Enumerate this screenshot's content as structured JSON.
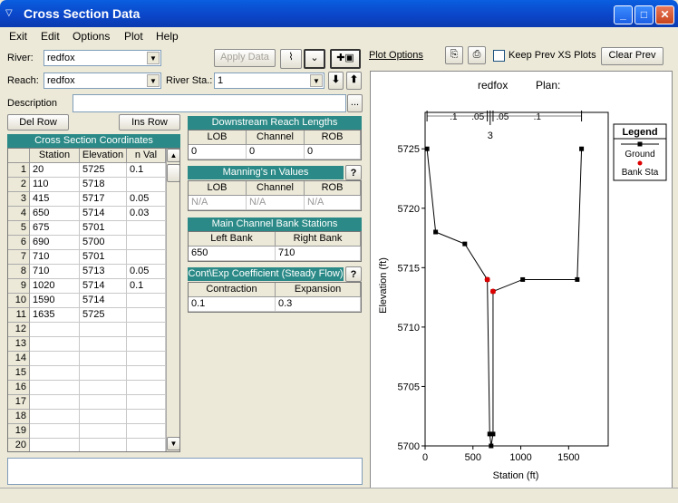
{
  "window": {
    "title": "Cross Section Data"
  },
  "menu": [
    "Exit",
    "Edit",
    "Options",
    "Plot",
    "Help"
  ],
  "form": {
    "river_label": "River:",
    "river_value": "redfox",
    "reach_label": "Reach:",
    "reach_value": "redfox",
    "river_sta_label": "River Sta.:",
    "river_sta_value": "1",
    "description_label": "Description",
    "apply_data": "Apply Data",
    "ellipsis": "..."
  },
  "plot_toolbar": {
    "plot_options": "Plot Options",
    "keep_prev": "Keep Prev XS Plots",
    "clear_prev": "Clear Prev"
  },
  "xs_table": {
    "del_row": "Del Row",
    "ins_row": "Ins Row",
    "title": "Cross Section Coordinates",
    "headers": [
      "Station",
      "Elevation",
      "n Val"
    ],
    "rows": [
      [
        "20",
        "5725",
        "0.1"
      ],
      [
        "110",
        "5718",
        ""
      ],
      [
        "415",
        "5717",
        "0.05"
      ],
      [
        "650",
        "5714",
        "0.03"
      ],
      [
        "675",
        "5701",
        ""
      ],
      [
        "690",
        "5700",
        ""
      ],
      [
        "710",
        "5701",
        ""
      ],
      [
        "710",
        "5713",
        "0.05"
      ],
      [
        "1020",
        "5714",
        "0.1"
      ],
      [
        "1590",
        "5714",
        ""
      ],
      [
        "1635",
        "5725",
        ""
      ],
      [
        "",
        "",
        ""
      ],
      [
        "",
        "",
        ""
      ],
      [
        "",
        "",
        ""
      ],
      [
        "",
        "",
        ""
      ],
      [
        "",
        "",
        ""
      ],
      [
        "",
        "",
        ""
      ],
      [
        "",
        "",
        ""
      ],
      [
        "",
        "",
        ""
      ],
      [
        "",
        "",
        ""
      ]
    ]
  },
  "reach_lengths": {
    "title": "Downstream Reach Lengths",
    "headers": [
      "LOB",
      "Channel",
      "ROB"
    ],
    "values": [
      "0",
      "0",
      "0"
    ]
  },
  "mannings": {
    "title": "Manning's n Values",
    "help": "?",
    "headers": [
      "LOB",
      "Channel",
      "ROB"
    ],
    "values": [
      "N/A",
      "N/A",
      "N/A"
    ]
  },
  "bank_stations": {
    "title": "Main Channel Bank Stations",
    "headers": [
      "Left Bank",
      "Right Bank"
    ],
    "values": [
      "650",
      "710"
    ]
  },
  "coefficients": {
    "title": "Cont\\Exp Coefficient (Steady Flow)",
    "help": "?",
    "headers": [
      "Contraction",
      "Expansion"
    ],
    "values": [
      "0.1",
      "0.3"
    ]
  },
  "plot_header": {
    "river": "redfox",
    "plan": "Plan:"
  },
  "legend": {
    "title": "Legend",
    "ground": "Ground",
    "bank": "Bank Sta",
    "ground_color": "#000000",
    "bank_color": "#dd0000"
  },
  "chart_data": {
    "type": "line",
    "xlabel": "Station (ft)",
    "ylabel": "Elevation (ft)",
    "xlim": [
      0,
      1800
    ],
    "ylim": [
      5700,
      5727
    ],
    "xticks": [
      0,
      500,
      1000,
      1500
    ],
    "yticks": [
      5700,
      5705,
      5710,
      5715,
      5720,
      5725
    ],
    "series": [
      {
        "name": "Ground",
        "x": [
          20,
          110,
          415,
          650,
          675,
          690,
          710,
          710,
          1020,
          1590,
          1635
        ],
        "y": [
          5725,
          5718,
          5717,
          5714,
          5701,
          5700,
          5701,
          5713,
          5714,
          5714,
          5725
        ]
      }
    ],
    "bank_stations": [
      {
        "x": 650,
        "y": 5714
      },
      {
        "x": 710,
        "y": 5713
      }
    ],
    "n_labels": [
      ".1",
      ".05",
      ".05",
      ".1"
    ],
    "channel_label": "3"
  }
}
